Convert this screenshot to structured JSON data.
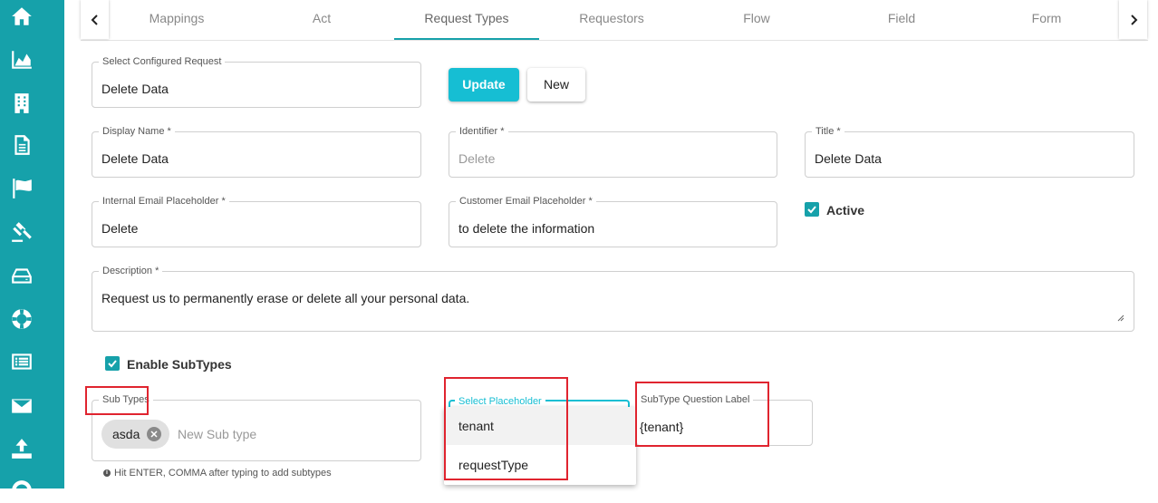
{
  "tabs": [
    "Mappings",
    "Act",
    "Request Types",
    "Requestors",
    "Flow",
    "Field",
    "Form"
  ],
  "active_tab": "Request Types",
  "select_request": {
    "label": "Select Configured Request",
    "value": "Delete Data"
  },
  "buttons": {
    "update": "Update",
    "new": "New"
  },
  "display_name": {
    "label": "Display Name *",
    "value": "Delete Data"
  },
  "identifier": {
    "label": "Identifier *",
    "placeholder": "Delete"
  },
  "title": {
    "label": "Title *",
    "value": "Delete Data"
  },
  "internal_email": {
    "label": "Internal Email Placeholder *",
    "value": "Delete"
  },
  "customer_email": {
    "label": "Customer Email Placeholder *",
    "value": "to delete the information"
  },
  "active": {
    "label": "Active",
    "checked": true
  },
  "description": {
    "label": "Description *",
    "value": "Request us to permanently erase or delete all your personal data."
  },
  "enable_subtypes": {
    "label": "Enable SubTypes",
    "checked": true
  },
  "sub_types": {
    "label": "Sub Types",
    "chips": [
      "asda"
    ],
    "placeholder": "New Sub type",
    "hint": "Hit ENTER, COMMA after typing to add subtypes"
  },
  "select_placeholder": {
    "label": "Select Placeholder",
    "options": [
      "tenant",
      "requestType"
    ]
  },
  "subtype_question": {
    "label": "SubType Question Label",
    "value": "{tenant}"
  },
  "colors": {
    "sidebar": "#16a1aa",
    "accent": "#16bed3",
    "highlight_box": "#e0242f"
  }
}
